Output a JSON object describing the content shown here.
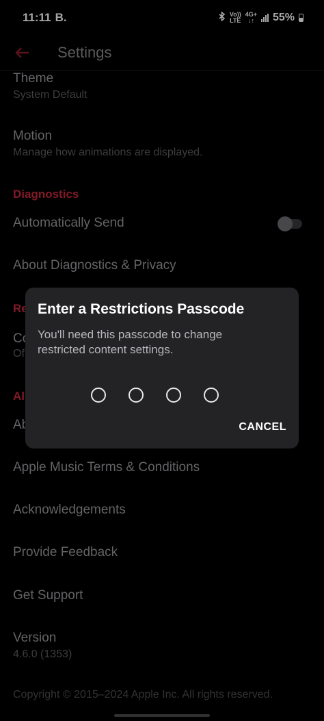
{
  "status_bar": {
    "time": "11:11",
    "notification_letter": "B.",
    "volte_top": "Vo))",
    "volte_bottom": "LTE",
    "net_top": "4G+",
    "net_bottom": "↓↑",
    "battery": "55%"
  },
  "header": {
    "title": "Settings",
    "accent_color": "#c8283c"
  },
  "settings": {
    "theme_title": "Theme",
    "theme_value": "System Default",
    "motion_title": "Motion",
    "motion_sub": "Manage how animations are displayed.",
    "diagnostics_header": "Diagnostics",
    "auto_send": "Automatically Send",
    "auto_send_enabled": false,
    "about_diag": "About Diagnostics & Privacy",
    "restrictions_header_partial": "Re",
    "content_title_partial": "Co",
    "content_sub_partial": "Of",
    "about_header_partial": "Al",
    "about_partial": "Ab",
    "terms": "Apple Music Terms & Conditions",
    "acknowledgements": "Acknowledgements",
    "feedback": "Provide Feedback",
    "support": "Get Support",
    "version_title": "Version",
    "version_value": "4.6.0 (1353)",
    "copyright": "Copyright © 2015–2024 Apple Inc. All rights reserved."
  },
  "dialog": {
    "title": "Enter a Restrictions Passcode",
    "message": "You'll need this passcode to change restricted content settings.",
    "cancel": "CANCEL",
    "passcode_length": 4
  }
}
